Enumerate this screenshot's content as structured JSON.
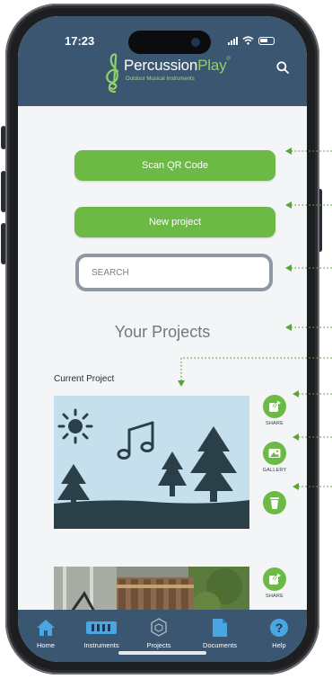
{
  "status_bar": {
    "time": "17:23"
  },
  "header": {
    "logo_word_1": "Percussion",
    "logo_word_2": "Play",
    "logo_trademark": "®",
    "logo_tagline": "Outdoor Musical Instruments",
    "search_icon": "search-icon"
  },
  "actions": {
    "scan_qr_label": "Scan QR Code",
    "new_project_label": "New project"
  },
  "search": {
    "placeholder": "SEARCH"
  },
  "projects": {
    "heading": "Your Projects",
    "current_label": "Current Project",
    "card_actions": [
      {
        "label": "SHARE",
        "icon": "share-icon"
      },
      {
        "label": "GALLERY",
        "icon": "gallery-icon"
      },
      {
        "label": "",
        "icon": "trash-icon"
      }
    ],
    "second_card_actions": [
      {
        "label": "SHARE",
        "icon": "share-icon"
      }
    ]
  },
  "tabbar": {
    "items": [
      {
        "label": "Home",
        "icon": "home-icon"
      },
      {
        "label": "Instruments",
        "icon": "instruments-icon"
      },
      {
        "label": "Projects",
        "icon": "projects-icon"
      },
      {
        "label": "Documents",
        "icon": "documents-icon"
      },
      {
        "label": "Help",
        "icon": "help-icon"
      }
    ]
  },
  "colors": {
    "header": "#3b5670",
    "accent_green": "#6cb945",
    "callout_green": "#5aa537",
    "background": "#f3f5f7"
  }
}
